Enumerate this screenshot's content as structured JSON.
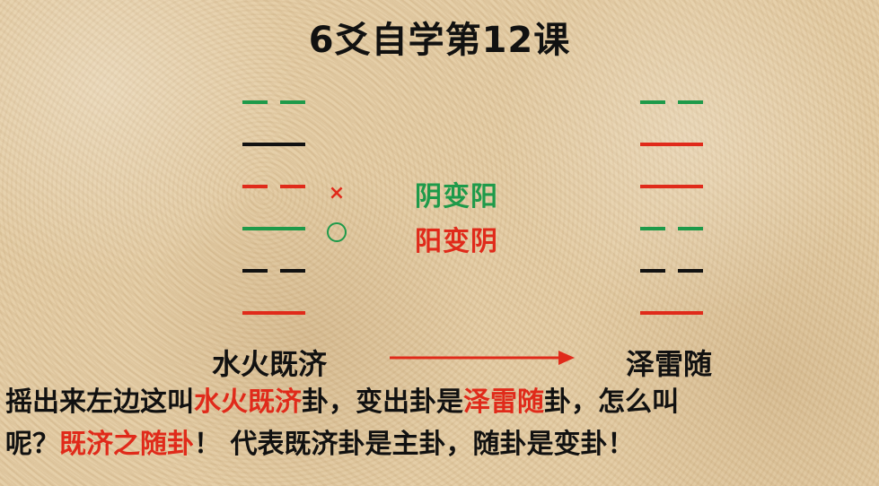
{
  "title": "6爻自学第12课",
  "colors": {
    "yin_to_yang": "#1e9a4a",
    "yang_to_yin": "#e02a1a",
    "unchanged": "#111111"
  },
  "hexagrams": {
    "left": {
      "name": "水火既济",
      "lines": [
        {
          "type": "yin",
          "color": "#1e9a4a"
        },
        {
          "type": "yang",
          "color": "#111111"
        },
        {
          "type": "yin",
          "color": "#e02a1a"
        },
        {
          "type": "yang",
          "color": "#1e9a4a"
        },
        {
          "type": "yin",
          "color": "#111111"
        },
        {
          "type": "yang",
          "color": "#e02a1a"
        }
      ]
    },
    "right": {
      "name": "泽雷随",
      "lines": [
        {
          "type": "yin",
          "color": "#1e9a4a"
        },
        {
          "type": "yang",
          "color": "#e02a1a"
        },
        {
          "type": "yang",
          "color": "#e02a1a"
        },
        {
          "type": "yin",
          "color": "#1e9a4a"
        },
        {
          "type": "yin",
          "color": "#111111"
        },
        {
          "type": "yang",
          "color": "#e02a1a"
        }
      ]
    }
  },
  "marks": {
    "x_symbol": "×",
    "o_symbol": "circle"
  },
  "legend": {
    "yin_to_yang": "阴变阳",
    "yang_to_yin": "阳变阴"
  },
  "paragraph": {
    "line1": [
      {
        "text": "摇出来左边这叫",
        "red": false
      },
      {
        "text": "水火既济",
        "red": true
      },
      {
        "text": "卦，变出卦是",
        "red": false
      },
      {
        "text": "泽雷随",
        "red": true
      },
      {
        "text": "卦，怎么叫",
        "red": false
      }
    ],
    "line2": [
      {
        "text": "呢？",
        "red": false
      },
      {
        "text": "既济之随卦",
        "red": true
      },
      {
        "text": "！ 代表既济卦是主卦，随卦是变卦！",
        "red": false
      }
    ]
  }
}
